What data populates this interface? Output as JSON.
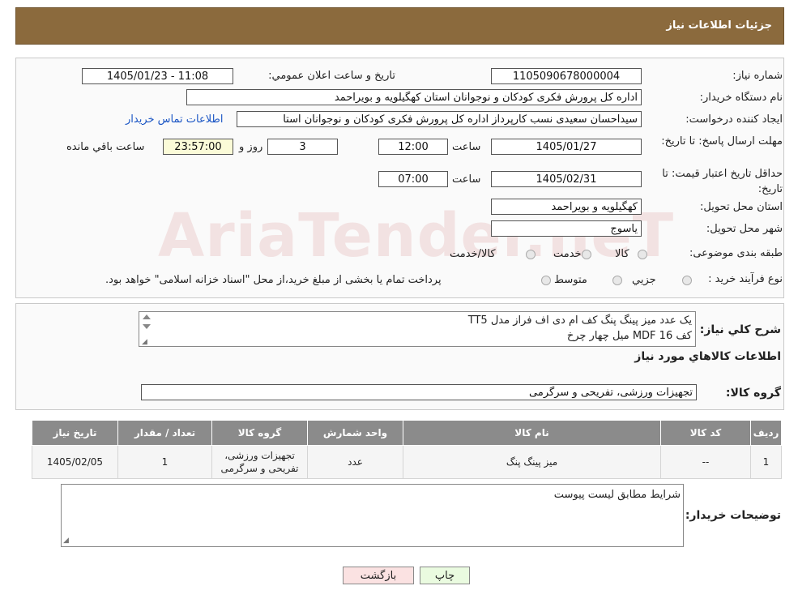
{
  "header": {
    "title": "جزئیات اطلاعات نیاز"
  },
  "watermark": "AriaTender.neT",
  "form": {
    "need_number_label": "شماره نیاز:",
    "need_number": "1105090678000004",
    "announce_label": "تاریخ و ساعت اعلان عمومي:",
    "announce_value": "1405/01/23 - 11:08",
    "buyer_label": "نام دستگاه خريدار:",
    "buyer_value": "اداره کل پرورش فکری کودکان و نوجوانان استان کهگیلویه و بویراحمد",
    "creator_label": "ايجاد کننده درخواست:",
    "creator_value": "سیداحسان سعیدی نسب کارپرداز اداره کل پرورش فکری کودکان و نوجوانان استا",
    "contact_link": "اطلاعات تماس خريدار",
    "deadline_label": "مهلت ارسال پاسخ: تا تاریخ:",
    "deadline_date": "1405/01/27",
    "time_label": "ساعت",
    "deadline_time": "12:00",
    "days_value": "3",
    "days_label": "روز و",
    "remaining_value": "23:57:00",
    "remaining_label": "ساعت باقي مانده",
    "validity_label": "حداقل تاريخ اعتبار قيمت: تا تاریخ:",
    "validity_date": "1405/02/31",
    "validity_time": "07:00",
    "province_label": "استان محل تحويل:",
    "province_value": "کهگیلویه و بویراحمد",
    "city_label": "شهر محل تحويل:",
    "city_value": "یاسوج",
    "category_label": "طبقه بندی موضوعی:",
    "category_options": [
      "کالا",
      "خدمت",
      "کالا/خدمت"
    ],
    "process_label": "نوع فرآيند خريد :",
    "process_options": [
      "جزيي",
      "متوسط"
    ],
    "process_note": "پرداخت تمام يا بخشی از مبلغ خريد،از محل \"اسناد خزانه اسلامی\" خواهد بود."
  },
  "summary": {
    "label": "شرح کلي نياز:",
    "line1": "یک عدد میز پینگ پنگ کف ام دی اف فراز مدل TT5",
    "line2": "کف 16 MDF    میل چهار چرخ"
  },
  "goods": {
    "section_title": "اطلاعات کالاهاي مورد نياز",
    "group_label": "گروه کالا:",
    "group_value": "تجهیزات ورزشی، تفریحی و سرگرمی",
    "columns": [
      "رديف",
      "کد کالا",
      "نام کالا",
      "واحد شمارش",
      "گروه کالا",
      "تعداد / مقدار",
      "تاريخ نياز"
    ],
    "rows": [
      {
        "index": "1",
        "code": "--",
        "name": "میز پینگ پنگ",
        "unit": "عدد",
        "group": "تجهیزات ورزشی، تفریحی و سرگرمی",
        "qty": "1",
        "date": "1405/02/05"
      }
    ]
  },
  "buyer_notes": {
    "label": "توضيحات خريدار:",
    "text": "شرایط مطابق لیست پیوست"
  },
  "buttons": {
    "print": "چاپ",
    "back": "بازگشت"
  }
}
